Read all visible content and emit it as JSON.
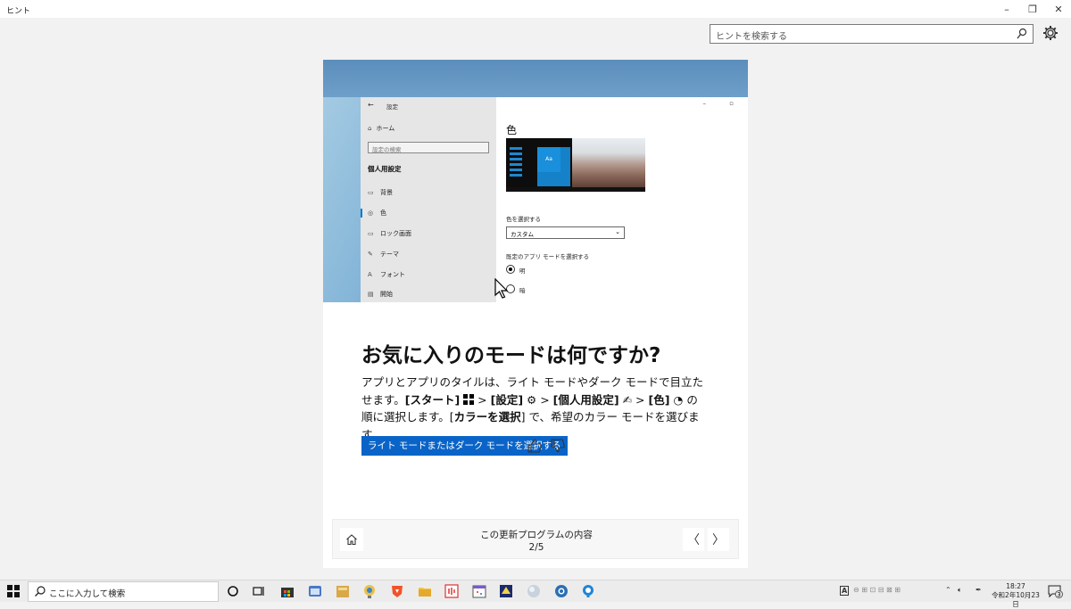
{
  "window": {
    "title": "ヒント",
    "minimize_glyph": "–",
    "restore_glyph": "❐",
    "close_glyph": "✕"
  },
  "search": {
    "placeholder": "ヒントを検索する",
    "icon": "search-icon"
  },
  "settings_icon": "gear-icon",
  "hero": {
    "settings_window": {
      "title": "設定",
      "back_glyph": "←",
      "home_label": "ホーム",
      "search_placeholder": "設定の検索",
      "section_heading": "個人用設定",
      "nav_items": [
        {
          "label": "背景",
          "icon": "▭"
        },
        {
          "label": "色",
          "icon": "◎"
        },
        {
          "label": "ロック画面",
          "icon": "▭"
        },
        {
          "label": "テーマ",
          "icon": "✎"
        },
        {
          "label": "フォント",
          "icon": "A"
        },
        {
          "label": "開始",
          "icon": "▤"
        }
      ],
      "selected_item": "色",
      "color_heading": "色",
      "preview_tile_label": "Aa",
      "choose_color_label": "色を選択する",
      "choose_color_value": "カスタム",
      "app_mode_label": "既定のアプリ モードを選択する",
      "mode_options": [
        {
          "label": "明",
          "selected": true
        },
        {
          "label": "暗",
          "selected": false
        }
      ]
    }
  },
  "tip": {
    "heading": "お気に入りのモードは何ですか?",
    "body_parts": {
      "p1": "アプリとアプリのタイルは、ライト モードやダーク モードで目立たせます。",
      "start": "[スタート]",
      "sep1": " > ",
      "settings": "[設定]",
      "sep2": " > ",
      "personal": "[個人用設定]",
      "sep3": " > ",
      "color": "[色]",
      "p2": " の順に選択します。[",
      "choose": "カラーを選択",
      "p3": "] で、希望のカラー モードを選びます。"
    },
    "action_button": "ライト モードまたはダーク モードを選択する",
    "like_icon": "thumbs-up-icon",
    "dislike_icon": "thumbs-down-icon"
  },
  "pager": {
    "title": "この更新プログラムの内容",
    "position": "2/5",
    "prev_glyph": "〈",
    "next_glyph": "〉"
  },
  "taskbar": {
    "search_placeholder": "ここに入力して検索",
    "clock_time": "18:27",
    "clock_date": "令和2年10月23日",
    "ime": "A",
    "notification_count": "3"
  }
}
